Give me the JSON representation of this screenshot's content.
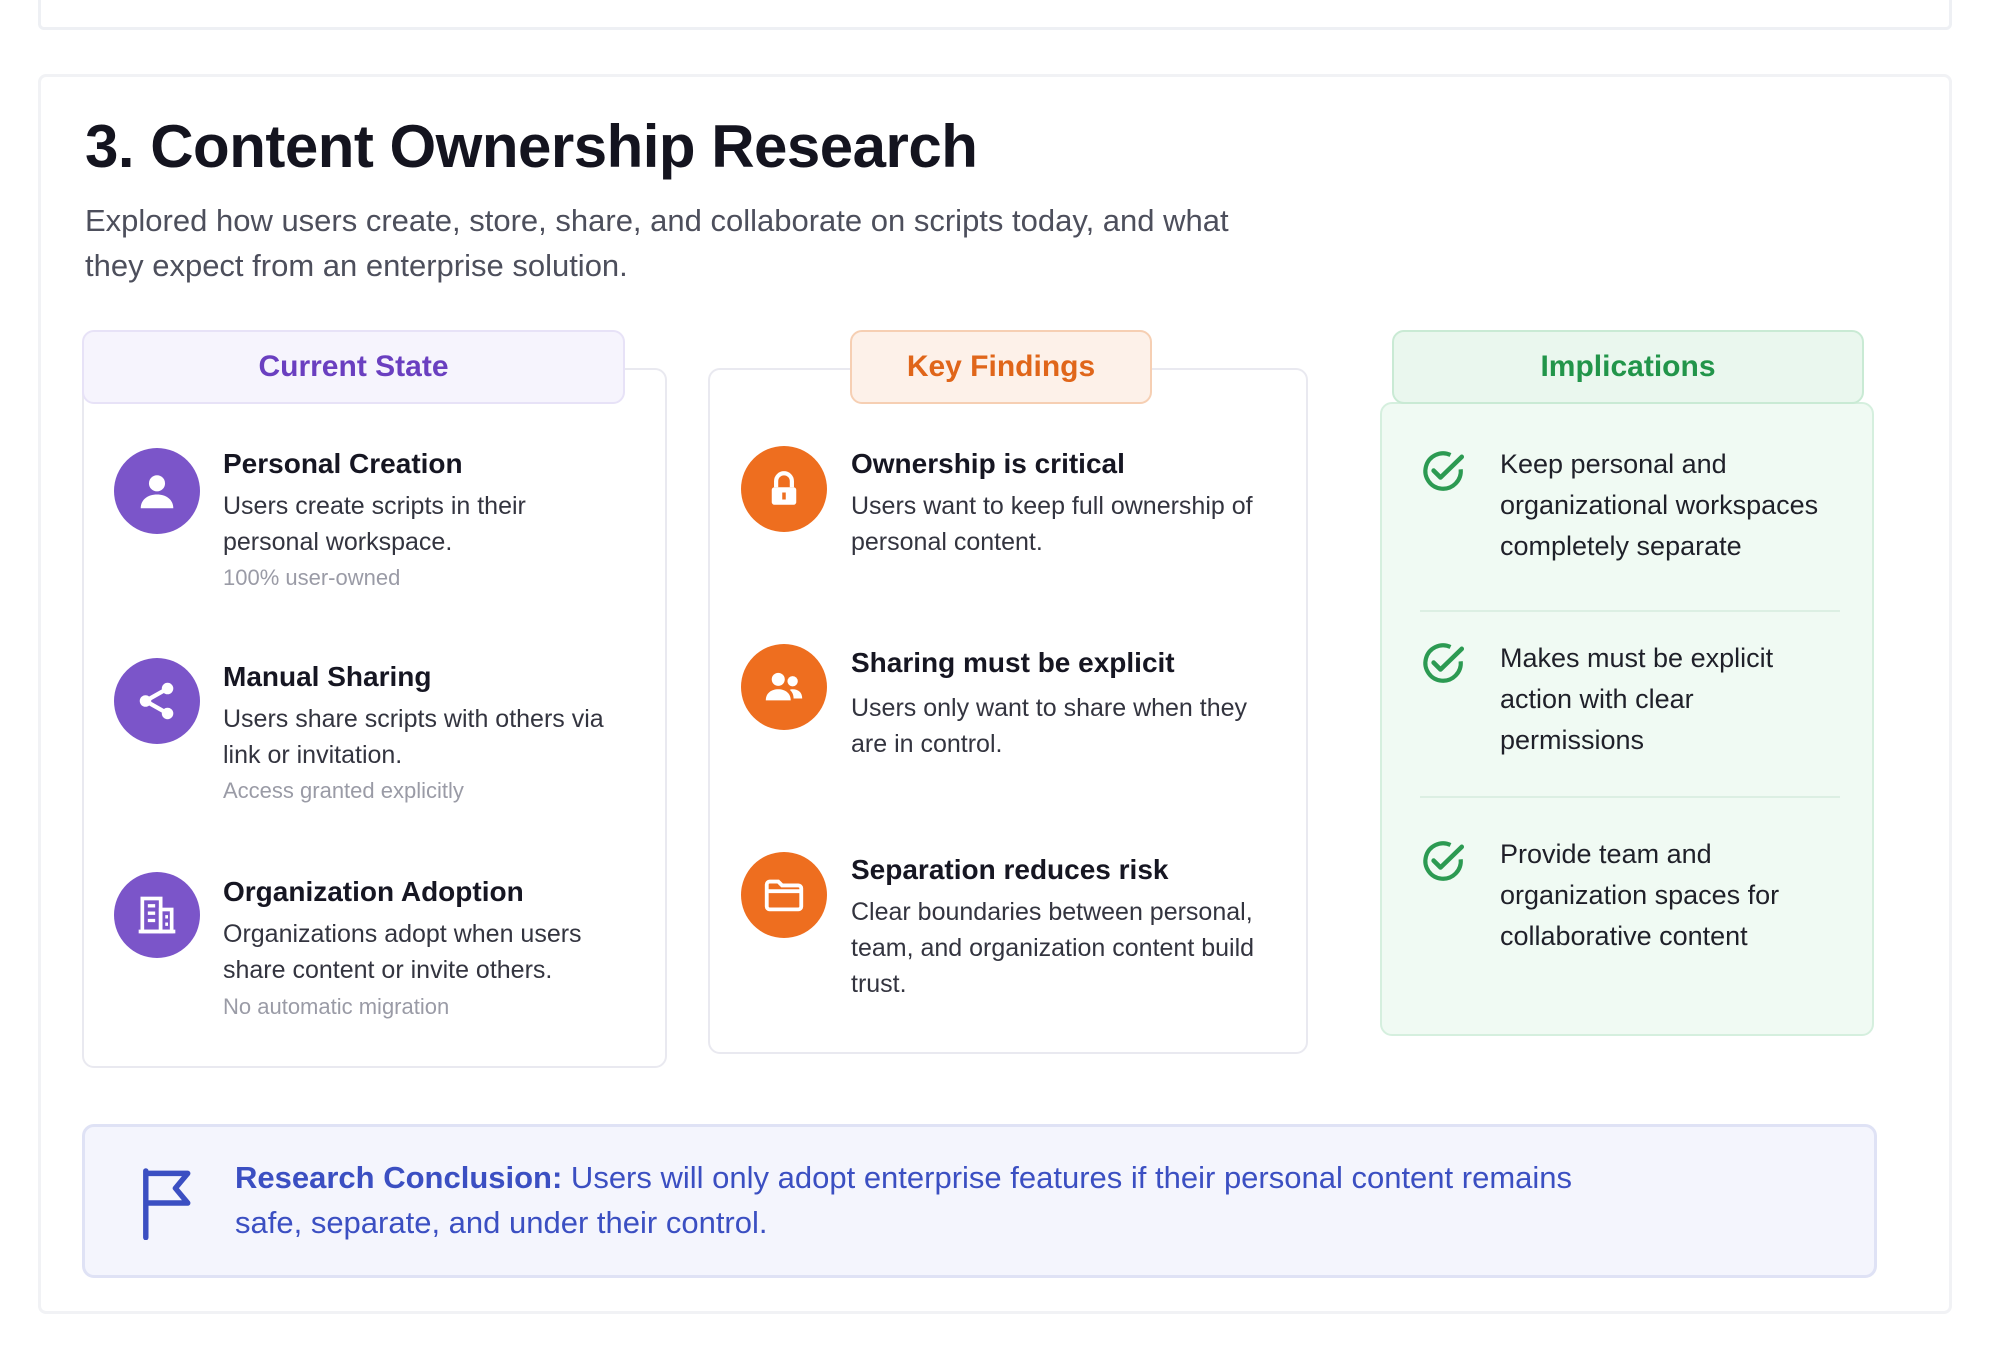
{
  "section": {
    "title": "3. Content Ownership Research",
    "subtitle": "Explored how users create, store, share, and collaborate on scripts today, and what they expect from an enterprise solution."
  },
  "columns": {
    "current_state": {
      "header": "Current State",
      "items": [
        {
          "icon": "user-icon",
          "title": "Personal Creation",
          "desc": "Users create scripts in their personal workspace.",
          "note": "100% user-owned"
        },
        {
          "icon": "share-icon",
          "title": "Manual Sharing",
          "desc": "Users share scripts with others via link or invitation.",
          "note": "Access granted explicitly"
        },
        {
          "icon": "building-icon",
          "title": "Organization Adoption",
          "desc": "Organizations adopt when users share content or invite others.",
          "note": "No automatic migration"
        }
      ]
    },
    "key_findings": {
      "header": "Key Findings",
      "items": [
        {
          "icon": "lock-icon",
          "title": "Ownership is critical",
          "desc": "Users want to keep full ownership of personal content."
        },
        {
          "icon": "users-icon",
          "title": "Sharing must be explicit",
          "desc": "Users only want to share when they are in control."
        },
        {
          "icon": "folder-icon",
          "title": "Separation reduces risk",
          "desc": "Clear boundaries between personal, team, and organization content build trust."
        }
      ]
    },
    "implications": {
      "header": "Implications",
      "items": [
        {
          "icon": "check-circle-icon",
          "text": "Keep personal and organizational workspaces completely separate"
        },
        {
          "icon": "check-circle-icon",
          "text": "Makes must be explicit action with clear permissions"
        },
        {
          "icon": "check-circle-icon",
          "text": "Provide team and organization spaces for collaborative content"
        }
      ]
    }
  },
  "conclusion": {
    "icon": "flag-icon",
    "label": "Research Conclusion:",
    "text": " Users will only adopt enterprise features if their personal content remains safe, separate, and under their control."
  },
  "colors": {
    "purple": "#7b55c9",
    "orange": "#ee6e1f",
    "green": "#22954a",
    "conclusion_blue": "#3b4fc2"
  }
}
